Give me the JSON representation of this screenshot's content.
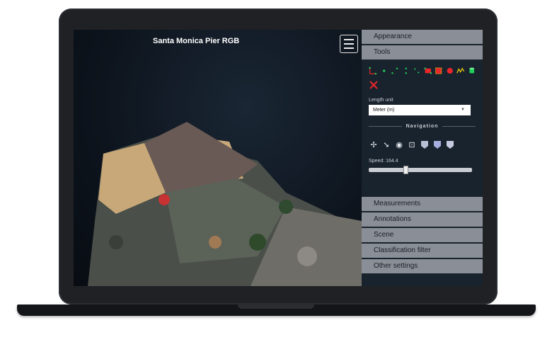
{
  "viewer": {
    "title": "Santa Monica Pier RGB"
  },
  "panel": {
    "appearance": "Appearance",
    "tools": "Tools",
    "length_unit_label": "Length unit",
    "length_unit_value": "Meter (m)",
    "navigation_title": "Navigation",
    "speed_label": "Speed: 164.4",
    "speed_level_fraction": 0.35,
    "measurements": "Measurements",
    "annotations": "Annotations",
    "scene": "Scene",
    "classification_filter": "Classification filter",
    "other_settings": "Other settings"
  },
  "icons": {
    "tools": [
      "angle-icon",
      "point-icon",
      "distance-icon",
      "height-icon",
      "circle-icon",
      "area-icon",
      "volume-box-icon",
      "volume-sphere-icon",
      "profile-icon",
      "cylinder-icon",
      "remove-all-icon"
    ],
    "navigation": [
      "earth-control-icon",
      "fly-control-icon",
      "orbit-control-icon",
      "focus-icon",
      "front-view-icon",
      "left-view-icon",
      "top-view-icon"
    ]
  },
  "colors": {
    "panel_bg": "#19232d",
    "accordion": "#8a8f97",
    "accent_green": "#1fd15a",
    "accent_red": "#e8262b"
  }
}
